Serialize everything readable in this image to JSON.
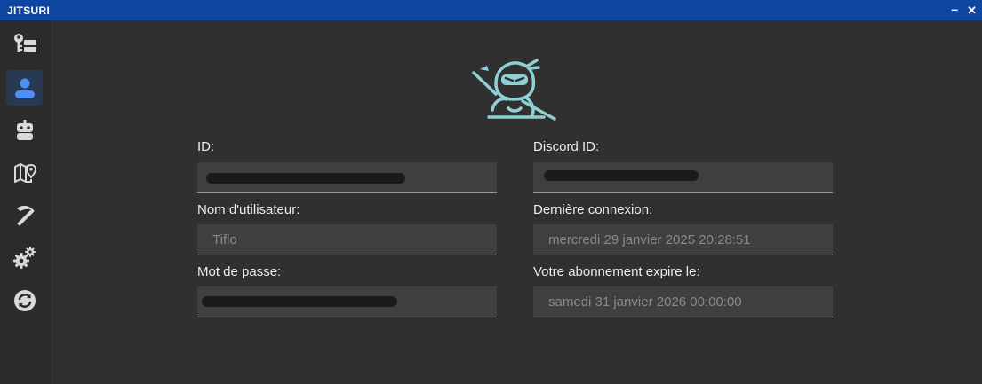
{
  "titlebar": {
    "app_title": "JITSURI",
    "minimize_glyph": "–",
    "close_glyph": "✕"
  },
  "sidebar": {
    "items": [
      {
        "name": "keys",
        "icon": "key-list-icon",
        "active": false
      },
      {
        "name": "account",
        "icon": "user-icon",
        "active": true
      },
      {
        "name": "bot",
        "icon": "robot-icon",
        "active": false
      },
      {
        "name": "map",
        "icon": "map-pin-icon",
        "active": false
      },
      {
        "name": "mining",
        "icon": "pickaxe-icon",
        "active": false
      },
      {
        "name": "settings",
        "icon": "gears-icon",
        "active": false
      },
      {
        "name": "sync",
        "icon": "sync-icon",
        "active": false
      }
    ],
    "active_color": "#4f8ff7",
    "icon_color": "#d9d9d9"
  },
  "logo": {
    "icon": "ninja-logo-icon",
    "color": "#8fd0d4"
  },
  "form": {
    "id_label": "ID:",
    "id_value": "",
    "discord_id_label": "Discord ID:",
    "discord_id_value": "",
    "username_label": "Nom d'utilisateur:",
    "username_value": "Tiflo",
    "last_login_label": "Dernière connexion:",
    "last_login_value": "mercredi 29 janvier 2025 20:28:51",
    "password_label": "Mot de passe:",
    "password_value": "",
    "expiry_label": "Votre abonnement expire le:",
    "expiry_value": "samedi 31 janvier 2026 00:00:00"
  }
}
